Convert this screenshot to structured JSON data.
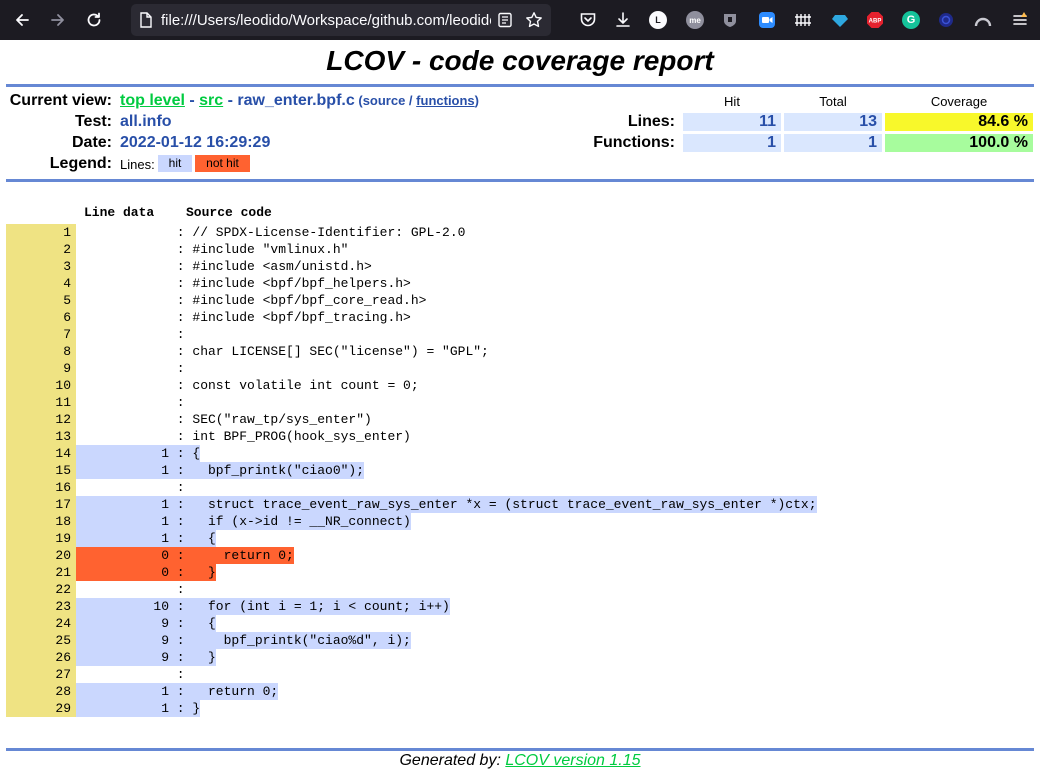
{
  "browser": {
    "url": "file:///Users/leodido/Workspace/github.com/leodido"
  },
  "page": {
    "title": "LCOV - code coverage report",
    "current_view_label": "Current view:",
    "breadcrumb": {
      "top_level": "top level",
      "sep1": " - ",
      "src": "src",
      "sep2": " - ",
      "file": "raw_enter.bpf.c",
      "source_prefix": " (source / ",
      "functions": "functions",
      "suffix": ")"
    },
    "test_label": "Test:",
    "test_value": "all.info",
    "date_label": "Date:",
    "date_value": "2022-01-12 16:29:29",
    "legend_label": "Legend:",
    "legend_lines": "Lines:",
    "legend_hit": "hit",
    "legend_not_hit": "not hit",
    "summary": {
      "col_hit": "Hit",
      "col_total": "Total",
      "col_coverage": "Coverage",
      "lines_label": "Lines:",
      "lines_hit": "11",
      "lines_total": "13",
      "lines_coverage": "84.6 %",
      "functions_label": "Functions:",
      "functions_hit": "1",
      "functions_total": "1",
      "functions_coverage": "100.0 %"
    },
    "code_header_line_data": "Line data",
    "code_header_source": "Source code",
    "footer_prefix": "Generated by: ",
    "footer_link": "LCOV version 1.15"
  },
  "colors": {
    "ruler": "#6688d4",
    "hit": "#cad7fe",
    "not_hit": "#ff6230",
    "line_number_bg": "#efe383",
    "coverage_medium": "#f8f82b",
    "coverage_high": "#a7fc9d",
    "link_green": "#00cb40"
  },
  "source_lines": [
    {
      "n": "1",
      "count": "",
      "status": "none",
      "code": "// SPDX-License-Identifier: GPL-2.0"
    },
    {
      "n": "2",
      "count": "",
      "status": "none",
      "code": "#include \"vmlinux.h\""
    },
    {
      "n": "3",
      "count": "",
      "status": "none",
      "code": "#include <asm/unistd.h>"
    },
    {
      "n": "4",
      "count": "",
      "status": "none",
      "code": "#include <bpf/bpf_helpers.h>"
    },
    {
      "n": "5",
      "count": "",
      "status": "none",
      "code": "#include <bpf/bpf_core_read.h>"
    },
    {
      "n": "6",
      "count": "",
      "status": "none",
      "code": "#include <bpf/bpf_tracing.h>"
    },
    {
      "n": "7",
      "count": "",
      "status": "none",
      "code": ""
    },
    {
      "n": "8",
      "count": "",
      "status": "none",
      "code": "char LICENSE[] SEC(\"license\") = \"GPL\";"
    },
    {
      "n": "9",
      "count": "",
      "status": "none",
      "code": ""
    },
    {
      "n": "10",
      "count": "",
      "status": "none",
      "code": "const volatile int count = 0;"
    },
    {
      "n": "11",
      "count": "",
      "status": "none",
      "code": ""
    },
    {
      "n": "12",
      "count": "",
      "status": "none",
      "code": "SEC(\"raw_tp/sys_enter\")"
    },
    {
      "n": "13",
      "count": "",
      "status": "none",
      "code": "int BPF_PROG(hook_sys_enter)"
    },
    {
      "n": "14",
      "count": "1",
      "status": "hit",
      "code": "{"
    },
    {
      "n": "15",
      "count": "1",
      "status": "hit",
      "code": "  bpf_printk(\"ciao0\");"
    },
    {
      "n": "16",
      "count": "",
      "status": "none",
      "code": ""
    },
    {
      "n": "17",
      "count": "1",
      "status": "hit",
      "code": "  struct trace_event_raw_sys_enter *x = (struct trace_event_raw_sys_enter *)ctx;"
    },
    {
      "n": "18",
      "count": "1",
      "status": "hit",
      "code": "  if (x->id != __NR_connect)"
    },
    {
      "n": "19",
      "count": "1",
      "status": "hit",
      "code": "  {"
    },
    {
      "n": "20",
      "count": "0",
      "status": "miss",
      "code": "    return 0;"
    },
    {
      "n": "21",
      "count": "0",
      "status": "miss",
      "code": "  }"
    },
    {
      "n": "22",
      "count": "",
      "status": "none",
      "code": ""
    },
    {
      "n": "23",
      "count": "10",
      "status": "hit",
      "code": "  for (int i = 1; i < count; i++)"
    },
    {
      "n": "24",
      "count": "9",
      "status": "hit",
      "code": "  {"
    },
    {
      "n": "25",
      "count": "9",
      "status": "hit",
      "code": "    bpf_printk(\"ciao%d\", i);"
    },
    {
      "n": "26",
      "count": "9",
      "status": "hit",
      "code": "  }"
    },
    {
      "n": "27",
      "count": "",
      "status": "none",
      "code": ""
    },
    {
      "n": "28",
      "count": "1",
      "status": "hit",
      "code": "  return 0;"
    },
    {
      "n": "29",
      "count": "1",
      "status": "hit",
      "code": "}"
    }
  ]
}
